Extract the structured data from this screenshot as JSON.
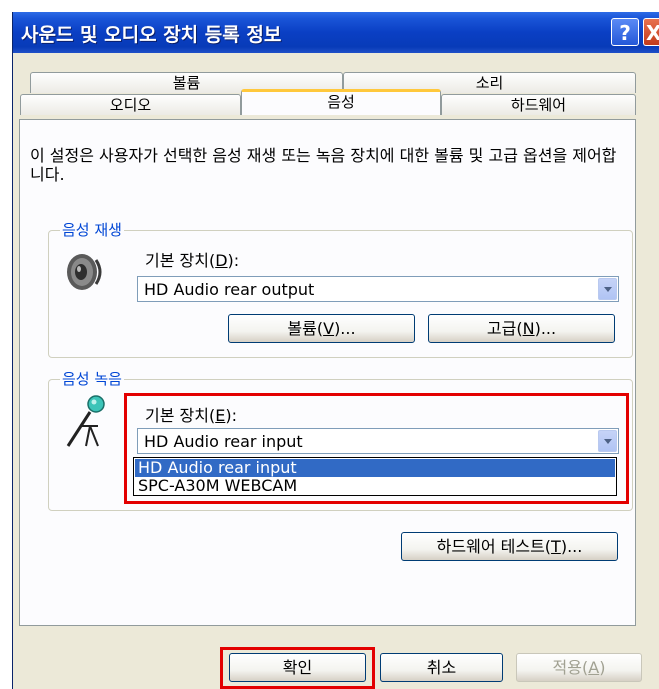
{
  "window": {
    "title": "사운드 및 오디오 장치 등록 정보",
    "help_glyph": "?",
    "close_glyph": "X"
  },
  "tabs": {
    "row1": [
      "볼륨",
      "소리"
    ],
    "row2": [
      "오디오",
      "음성",
      "하드웨어"
    ],
    "active": "음성"
  },
  "description": "이 설정은 사용자가 선택한 음성 재생 또는 녹음 장치에 대한 볼륨 및 고급 옵션을 제어합니다.",
  "playback": {
    "group_label": "음성 재생",
    "device_label_prefix": "기본 장치(",
    "device_label_key": "D",
    "device_label_suffix": "):",
    "selected_device": "HD Audio rear output",
    "volume_button": {
      "prefix": "볼륨(",
      "key": "V",
      "suffix": ")..."
    },
    "advanced_button": {
      "prefix": "고급(",
      "key": "N",
      "suffix": ")..."
    }
  },
  "recording": {
    "group_label": "음성 녹음",
    "device_label_prefix": "기본 장치(",
    "device_label_key": "E",
    "device_label_suffix": "):",
    "selected_device": "HD Audio rear input",
    "options": [
      "HD Audio rear input",
      "SPC-A30M WEBCAM"
    ]
  },
  "hardware_test_button": {
    "prefix": "하드웨어 테스트(",
    "key": "T",
    "suffix": ")..."
  },
  "footer": {
    "ok": "확인",
    "cancel": "취소",
    "apply": {
      "prefix": "적용(",
      "key": "A",
      "suffix": ")"
    }
  },
  "colors": {
    "highlight": "#e30000",
    "title_bar": "#0a3fc4",
    "selection": "#316ac5",
    "group_label": "#0046d5",
    "active_tab_accent": "#ffc83c"
  }
}
